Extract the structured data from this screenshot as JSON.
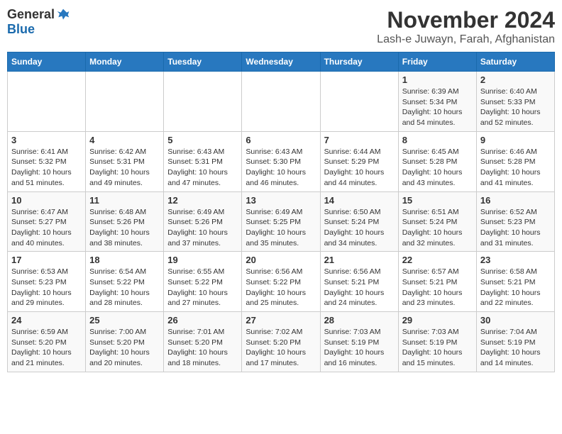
{
  "logo": {
    "general": "General",
    "blue": "Blue"
  },
  "title": "November 2024",
  "location": "Lash-e Juwayn, Farah, Afghanistan",
  "headers": [
    "Sunday",
    "Monday",
    "Tuesday",
    "Wednesday",
    "Thursday",
    "Friday",
    "Saturday"
  ],
  "weeks": [
    [
      {
        "day": "",
        "content": ""
      },
      {
        "day": "",
        "content": ""
      },
      {
        "day": "",
        "content": ""
      },
      {
        "day": "",
        "content": ""
      },
      {
        "day": "",
        "content": ""
      },
      {
        "day": "1",
        "content": "Sunrise: 6:39 AM\nSunset: 5:34 PM\nDaylight: 10 hours and 54 minutes."
      },
      {
        "day": "2",
        "content": "Sunrise: 6:40 AM\nSunset: 5:33 PM\nDaylight: 10 hours and 52 minutes."
      }
    ],
    [
      {
        "day": "3",
        "content": "Sunrise: 6:41 AM\nSunset: 5:32 PM\nDaylight: 10 hours and 51 minutes."
      },
      {
        "day": "4",
        "content": "Sunrise: 6:42 AM\nSunset: 5:31 PM\nDaylight: 10 hours and 49 minutes."
      },
      {
        "day": "5",
        "content": "Sunrise: 6:43 AM\nSunset: 5:31 PM\nDaylight: 10 hours and 47 minutes."
      },
      {
        "day": "6",
        "content": "Sunrise: 6:43 AM\nSunset: 5:30 PM\nDaylight: 10 hours and 46 minutes."
      },
      {
        "day": "7",
        "content": "Sunrise: 6:44 AM\nSunset: 5:29 PM\nDaylight: 10 hours and 44 minutes."
      },
      {
        "day": "8",
        "content": "Sunrise: 6:45 AM\nSunset: 5:28 PM\nDaylight: 10 hours and 43 minutes."
      },
      {
        "day": "9",
        "content": "Sunrise: 6:46 AM\nSunset: 5:28 PM\nDaylight: 10 hours and 41 minutes."
      }
    ],
    [
      {
        "day": "10",
        "content": "Sunrise: 6:47 AM\nSunset: 5:27 PM\nDaylight: 10 hours and 40 minutes."
      },
      {
        "day": "11",
        "content": "Sunrise: 6:48 AM\nSunset: 5:26 PM\nDaylight: 10 hours and 38 minutes."
      },
      {
        "day": "12",
        "content": "Sunrise: 6:49 AM\nSunset: 5:26 PM\nDaylight: 10 hours and 37 minutes."
      },
      {
        "day": "13",
        "content": "Sunrise: 6:49 AM\nSunset: 5:25 PM\nDaylight: 10 hours and 35 minutes."
      },
      {
        "day": "14",
        "content": "Sunrise: 6:50 AM\nSunset: 5:24 PM\nDaylight: 10 hours and 34 minutes."
      },
      {
        "day": "15",
        "content": "Sunrise: 6:51 AM\nSunset: 5:24 PM\nDaylight: 10 hours and 32 minutes."
      },
      {
        "day": "16",
        "content": "Sunrise: 6:52 AM\nSunset: 5:23 PM\nDaylight: 10 hours and 31 minutes."
      }
    ],
    [
      {
        "day": "17",
        "content": "Sunrise: 6:53 AM\nSunset: 5:23 PM\nDaylight: 10 hours and 29 minutes."
      },
      {
        "day": "18",
        "content": "Sunrise: 6:54 AM\nSunset: 5:22 PM\nDaylight: 10 hours and 28 minutes."
      },
      {
        "day": "19",
        "content": "Sunrise: 6:55 AM\nSunset: 5:22 PM\nDaylight: 10 hours and 27 minutes."
      },
      {
        "day": "20",
        "content": "Sunrise: 6:56 AM\nSunset: 5:22 PM\nDaylight: 10 hours and 25 minutes."
      },
      {
        "day": "21",
        "content": "Sunrise: 6:56 AM\nSunset: 5:21 PM\nDaylight: 10 hours and 24 minutes."
      },
      {
        "day": "22",
        "content": "Sunrise: 6:57 AM\nSunset: 5:21 PM\nDaylight: 10 hours and 23 minutes."
      },
      {
        "day": "23",
        "content": "Sunrise: 6:58 AM\nSunset: 5:21 PM\nDaylight: 10 hours and 22 minutes."
      }
    ],
    [
      {
        "day": "24",
        "content": "Sunrise: 6:59 AM\nSunset: 5:20 PM\nDaylight: 10 hours and 21 minutes."
      },
      {
        "day": "25",
        "content": "Sunrise: 7:00 AM\nSunset: 5:20 PM\nDaylight: 10 hours and 20 minutes."
      },
      {
        "day": "26",
        "content": "Sunrise: 7:01 AM\nSunset: 5:20 PM\nDaylight: 10 hours and 18 minutes."
      },
      {
        "day": "27",
        "content": "Sunrise: 7:02 AM\nSunset: 5:20 PM\nDaylight: 10 hours and 17 minutes."
      },
      {
        "day": "28",
        "content": "Sunrise: 7:03 AM\nSunset: 5:19 PM\nDaylight: 10 hours and 16 minutes."
      },
      {
        "day": "29",
        "content": "Sunrise: 7:03 AM\nSunset: 5:19 PM\nDaylight: 10 hours and 15 minutes."
      },
      {
        "day": "30",
        "content": "Sunrise: 7:04 AM\nSunset: 5:19 PM\nDaylight: 10 hours and 14 minutes."
      }
    ]
  ]
}
